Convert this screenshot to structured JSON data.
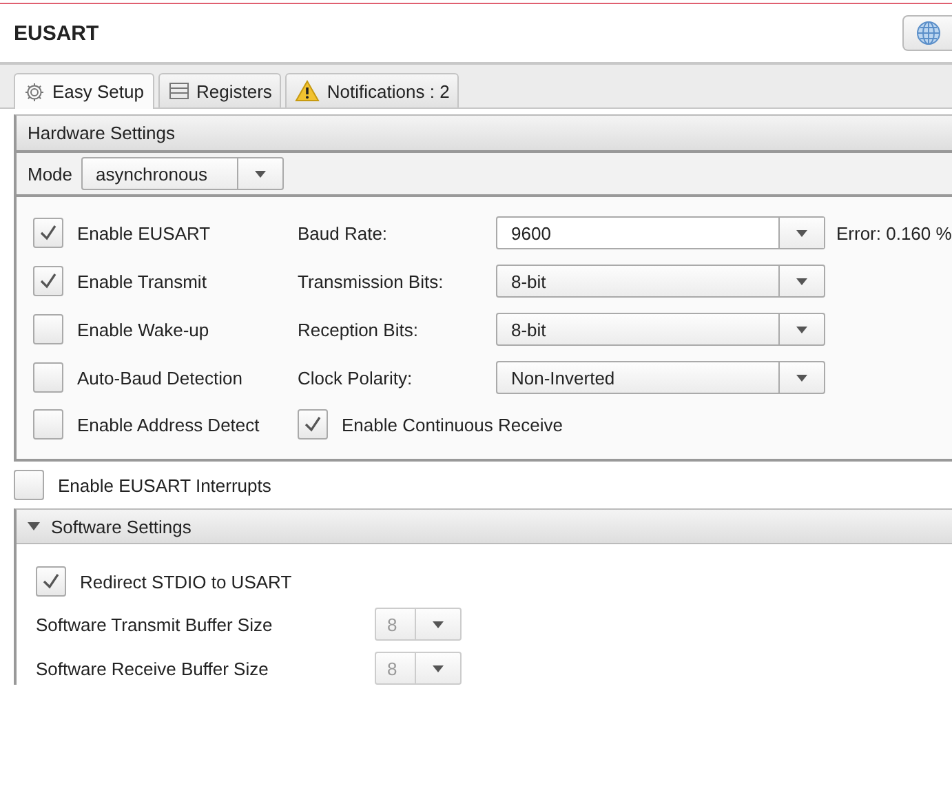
{
  "window": {
    "title": "EUSART"
  },
  "tabs": [
    {
      "label": "Easy Setup",
      "selected": true
    },
    {
      "label": "Registers",
      "selected": false
    },
    {
      "label": "Notifications : 2",
      "selected": false
    }
  ],
  "hardware": {
    "header": "Hardware Settings",
    "mode": {
      "label": "Mode",
      "value": "asynchronous"
    },
    "rows": [
      {
        "check": {
          "label": "Enable EUSART",
          "checked": true
        },
        "field": {
          "kind": "editable-combo",
          "label": "Baud Rate:",
          "value": "9600",
          "note": "Error: 0.160 %"
        }
      },
      {
        "check": {
          "label": "Enable Transmit",
          "checked": true
        },
        "field": {
          "kind": "combo",
          "label": "Transmission Bits:",
          "value": "8-bit"
        }
      },
      {
        "check": {
          "label": "Enable Wake-up",
          "checked": false
        },
        "field": {
          "kind": "combo",
          "label": "Reception Bits:",
          "value": "8-bit"
        }
      },
      {
        "check": {
          "label": "Auto-Baud Detection",
          "checked": false
        },
        "field": {
          "kind": "combo",
          "label": "Clock Polarity:",
          "value": "Non-Inverted"
        }
      },
      {
        "check": {
          "label": "Enable Address Detect",
          "checked": false
        },
        "field": {
          "kind": "checkbox",
          "label": "Enable Continuous Receive",
          "checked": true
        }
      }
    ]
  },
  "interrupts": {
    "label": "Enable EUSART Interrupts",
    "checked": false
  },
  "software": {
    "header": "Software Settings",
    "expanded": true,
    "redirect": {
      "label": "Redirect STDIO to USART",
      "checked": true
    },
    "buffers": [
      {
        "label": "Software Transmit Buffer Size",
        "value": "8",
        "disabled": true
      },
      {
        "label": "Software Receive Buffer Size",
        "value": "8",
        "disabled": true
      }
    ]
  }
}
